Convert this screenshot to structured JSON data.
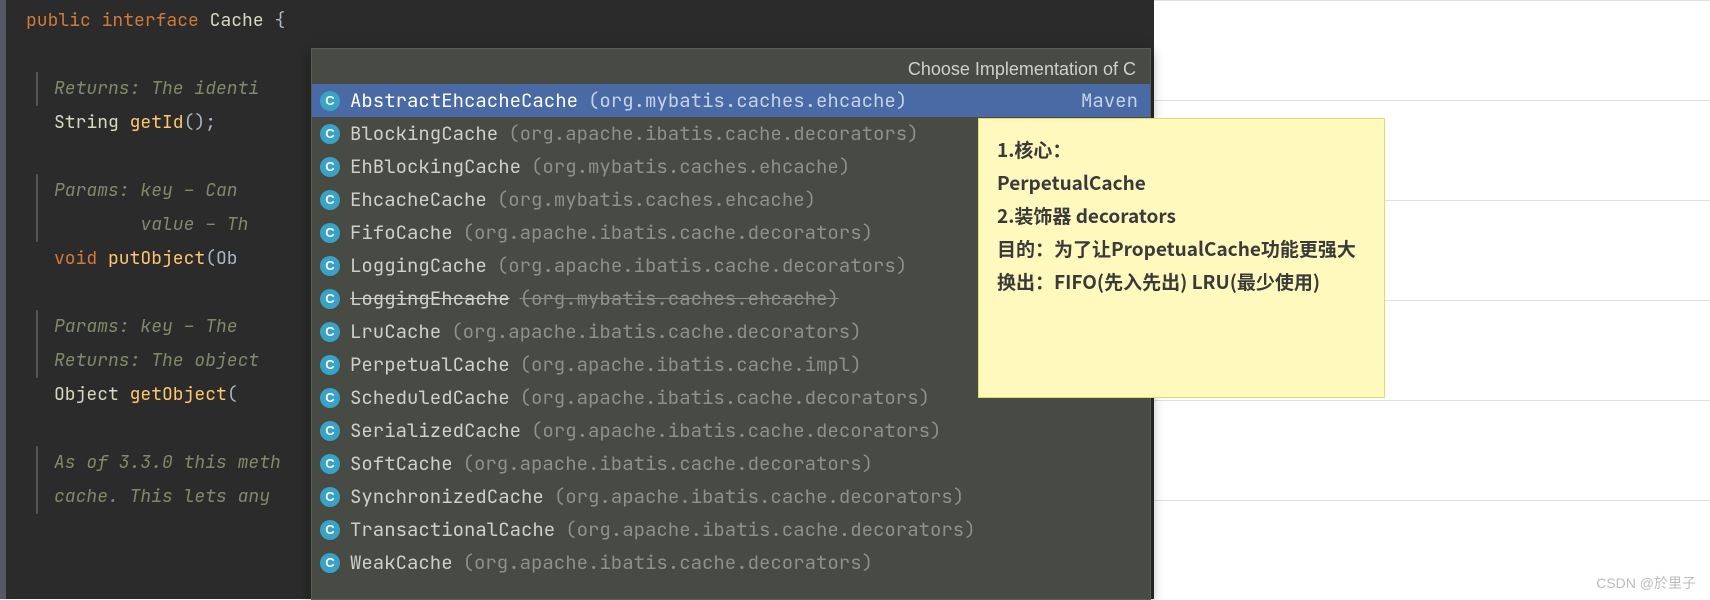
{
  "code": {
    "line1_kw1": "public",
    "line1_kw2": "interface",
    "line1_type": "Cache",
    "line1_brace": " {",
    "doc1": "Returns: The identi",
    "line2_type": "String ",
    "line2_method": "getId",
    "line2_rest": "();",
    "doc2a": "Params: key – Can ",
    "doc2b": "        value – Th",
    "line3_kw": "void ",
    "line3_method": "putObject",
    "line3_rest": "(Ob",
    "doc3a": "Params: key – The ",
    "doc3b": "Returns: The object",
    "line4_type": "Object ",
    "line4_method": "getObject",
    "line4_rest": "(",
    "doc4a": "As of 3.3.0 this meth",
    "doc4b": "cache. This lets any"
  },
  "popup": {
    "title": "Choose Implementation of C",
    "items": [
      {
        "name": "AbstractEhcacheCache",
        "pkg": "(org.mybatis.caches.ehcache)",
        "selected": true,
        "meta": "Maven"
      },
      {
        "name": "BlockingCache",
        "pkg": "(org.apache.ibatis.cache.decorators)"
      },
      {
        "name": "EhBlockingCache",
        "pkg": "(org.mybatis.caches.ehcache)"
      },
      {
        "name": "EhcacheCache",
        "pkg": "(org.mybatis.caches.ehcache)"
      },
      {
        "name": "FifoCache",
        "pkg": "(org.apache.ibatis.cache.decorators)"
      },
      {
        "name": "LoggingCache",
        "pkg": "(org.apache.ibatis.cache.decorators)"
      },
      {
        "name": "LoggingEhcache",
        "pkg": "(org.mybatis.caches.ehcache)",
        "strike": true
      },
      {
        "name": "LruCache",
        "pkg": "(org.apache.ibatis.cache.decorators)"
      },
      {
        "name": "PerpetualCache",
        "pkg": "(org.apache.ibatis.cache.impl)"
      },
      {
        "name": "ScheduledCache",
        "pkg": "(org.apache.ibatis.cache.decorators)"
      },
      {
        "name": "SerializedCache",
        "pkg": "(org.apache.ibatis.cache.decorators)"
      },
      {
        "name": "SoftCache",
        "pkg": "(org.apache.ibatis.cache.decorators)"
      },
      {
        "name": "SynchronizedCache",
        "pkg": "(org.apache.ibatis.cache.decorators)"
      },
      {
        "name": "TransactionalCache",
        "pkg": "(org.apache.ibatis.cache.decorators)"
      },
      {
        "name": "WeakCache",
        "pkg": "(org.apache.ibatis.cache.decorators)"
      }
    ]
  },
  "note": {
    "lines": [
      "1.核心：",
      "PerpetualCache",
      "2.装饰器 decorators",
      "目的：为了让PropetualCache功能更强大",
      "换出：FIFO(先入先出)    LRU(最少使用)"
    ]
  },
  "watermark": "CSDN @於里子"
}
